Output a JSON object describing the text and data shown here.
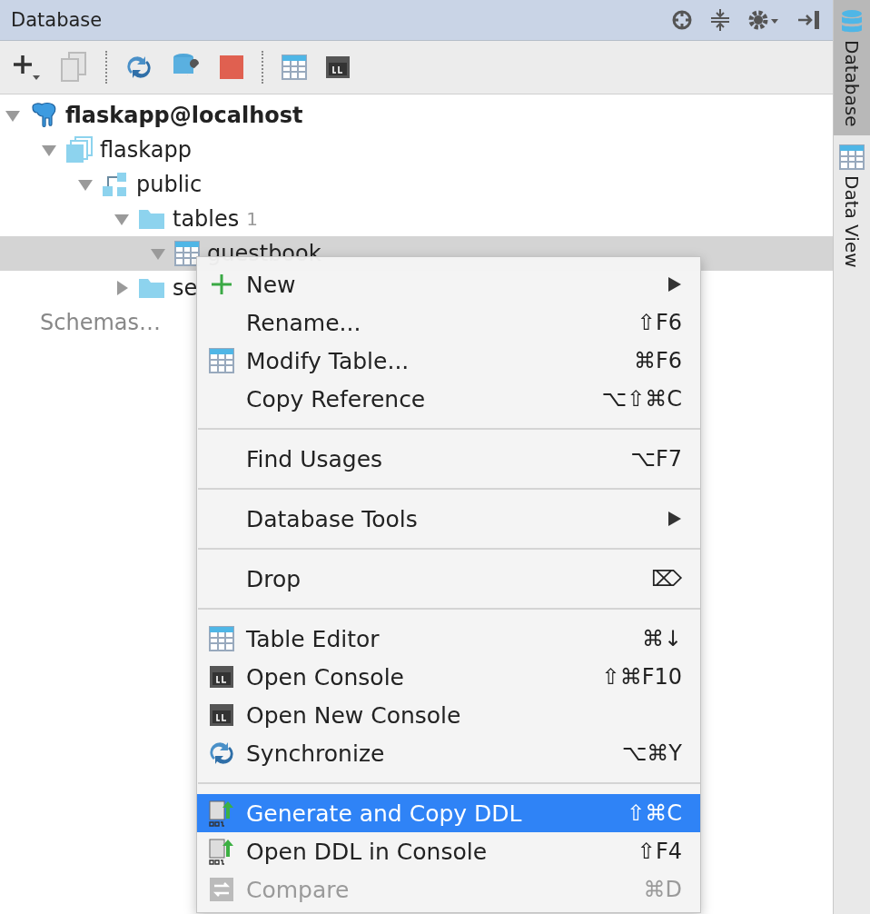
{
  "panel": {
    "title": "Database"
  },
  "toolbar": [
    {
      "kind": "add"
    },
    {
      "kind": "copy",
      "disabled": true
    },
    {
      "kind": "sep"
    },
    {
      "kind": "sync"
    },
    {
      "kind": "tools"
    },
    {
      "kind": "stop"
    },
    {
      "kind": "sep"
    },
    {
      "kind": "table"
    },
    {
      "kind": "console"
    }
  ],
  "tree": [
    {
      "label": "flaskapp@localhost",
      "kind": "server",
      "expanded": true,
      "bold": true,
      "children": [
        {
          "label": "flaskapp",
          "kind": "database",
          "expanded": true,
          "children": [
            {
              "label": "public",
              "kind": "schema",
              "expanded": true,
              "children": [
                {
                  "label": "tables",
                  "count": "1",
                  "kind": "folder",
                  "expanded": true,
                  "children": [
                    {
                      "label": "guestbook",
                      "kind": "table",
                      "expanded": true,
                      "selected": true
                    }
                  ]
                },
                {
                  "label": "se",
                  "kind": "folder",
                  "expanded": false
                }
              ]
            }
          ]
        },
        {
          "label": "Schemas…",
          "kind": "more"
        }
      ]
    }
  ],
  "side_tabs": [
    {
      "label": "Database",
      "kind": "database",
      "selected": true
    },
    {
      "label": "Data View",
      "kind": "table",
      "selected": false
    }
  ],
  "menu": [
    {
      "kind": "plus",
      "label": "New",
      "submenu": true,
      "selected": false
    },
    {
      "kind": "plain",
      "label": "Rename...",
      "shortcut": "⇧F6",
      "selected": false
    },
    {
      "kind": "table",
      "label": "Modify Table...",
      "shortcut": "⌘F6",
      "selected": false
    },
    {
      "kind": "plain",
      "label": "Copy Reference",
      "shortcut": "⌥⇧⌘C",
      "selected": false
    },
    {
      "kind": "separator"
    },
    {
      "kind": "plain",
      "label": "Find Usages",
      "shortcut": "⌥F7",
      "selected": false
    },
    {
      "kind": "separator"
    },
    {
      "kind": "plain",
      "label": "Database Tools",
      "submenu": true,
      "selected": false
    },
    {
      "kind": "separator"
    },
    {
      "kind": "plain",
      "label": "Drop",
      "shortcut": "⌦",
      "selected": false
    },
    {
      "kind": "separator"
    },
    {
      "kind": "table",
      "label": "Table Editor",
      "shortcut": "⌘↓",
      "selected": false
    },
    {
      "kind": "console",
      "label": "Open Console",
      "shortcut": "⇧⌘F10",
      "selected": false
    },
    {
      "kind": "console",
      "label": "Open New Console",
      "selected": false
    },
    {
      "kind": "sync",
      "label": "Synchronize",
      "shortcut": "⌥⌘Y",
      "selected": false
    },
    {
      "kind": "separator"
    },
    {
      "kind": "ddl",
      "label": "Generate and Copy DDL",
      "shortcut": "⇧⌘C",
      "selected": true
    },
    {
      "kind": "ddl",
      "label": "Open DDL in Console",
      "shortcut": "⇧F4",
      "selected": false
    },
    {
      "kind": "compare",
      "label": "Compare",
      "shortcut": "⌘D",
      "disabled": true,
      "selected": false
    }
  ]
}
